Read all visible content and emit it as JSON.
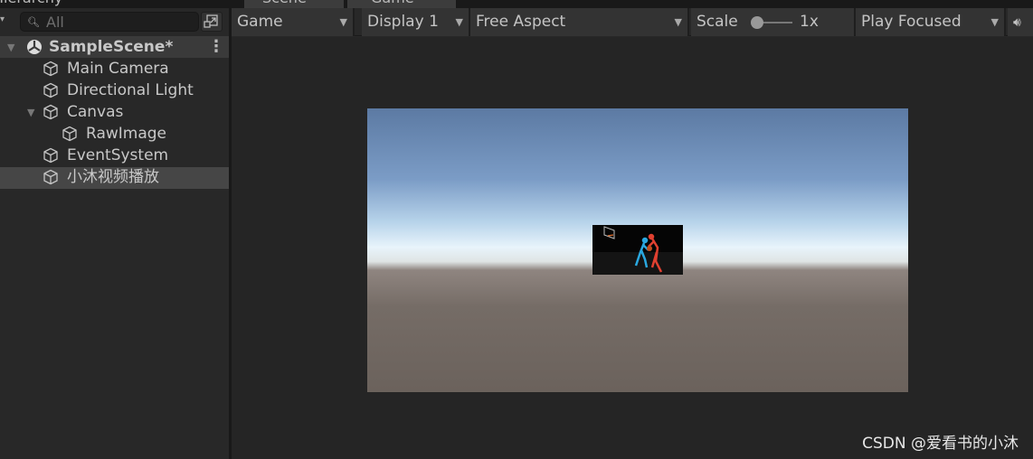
{
  "tabs": [
    {
      "label": "Hierarchy"
    },
    {
      "label": "Scene"
    },
    {
      "label": "Game"
    }
  ],
  "hierarchy": {
    "search_placeholder": "All",
    "scene": "SampleScene*",
    "items": [
      {
        "label": "Main Camera",
        "depth": 1
      },
      {
        "label": "Directional Light",
        "depth": 1
      },
      {
        "label": "Canvas",
        "depth": 1,
        "expanded": true
      },
      {
        "label": "RawImage",
        "depth": 2
      },
      {
        "label": "EventSystem",
        "depth": 1
      },
      {
        "label": "小沐视频播放",
        "depth": 1,
        "selected": true
      }
    ]
  },
  "toolbar": {
    "mode": "Game",
    "display": "Display 1",
    "aspect": "Free Aspect",
    "scale_label": "Scale",
    "scale_value": "1x",
    "play_mode": "Play Focused"
  },
  "watermark": "CSDN @爱看书的小沐"
}
